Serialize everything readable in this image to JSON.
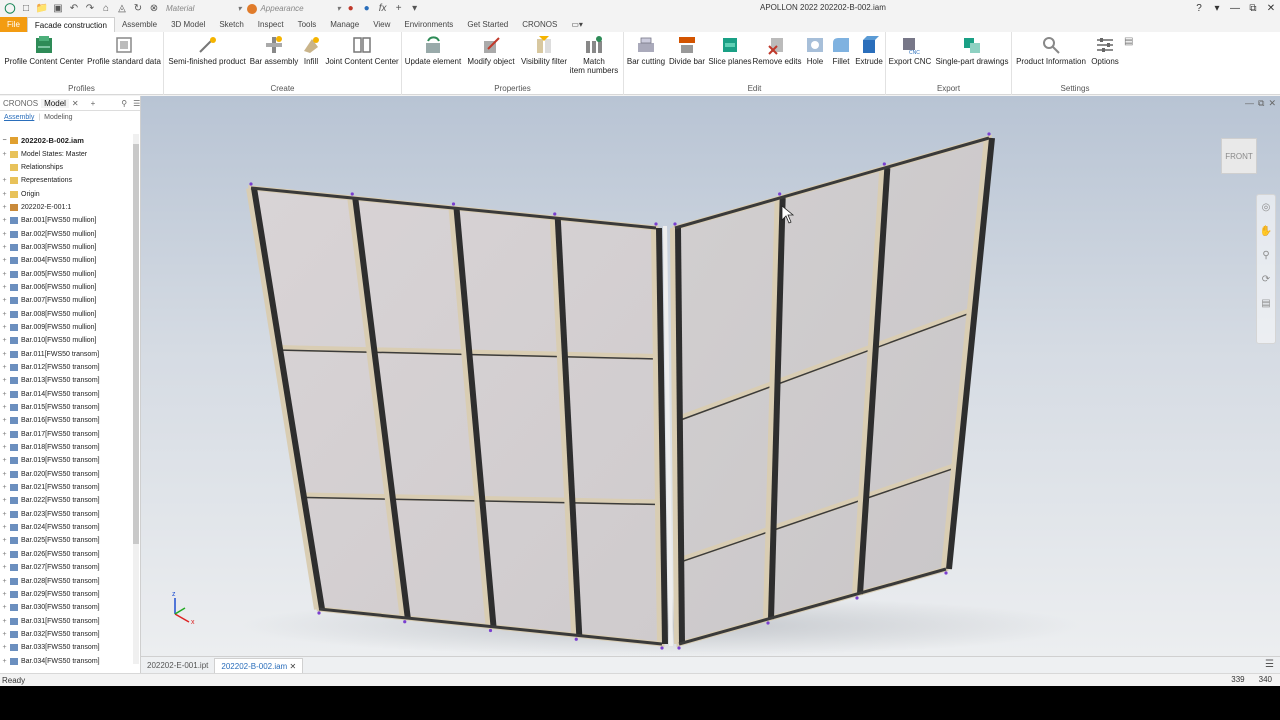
{
  "title": "APOLLON 2022   202202-B-002.iam",
  "quick_access": {
    "material": "Material",
    "appearance": "Appearance"
  },
  "tabs": [
    "File",
    "Facade construction",
    "Assemble",
    "3D Model",
    "Sketch",
    "Inspect",
    "Tools",
    "Manage",
    "View",
    "Environments",
    "Get Started",
    "CRONOS"
  ],
  "ribbon": {
    "groups": {
      "profiles": "Profiles",
      "create": "Create",
      "properties": "Properties",
      "edit": "Edit",
      "export": "Export",
      "settings": "Settings"
    },
    "buttons": {
      "profile_content_center": "Profile Content Center",
      "profile_standard_data": "Profile standard data",
      "semi_finished_product": "Semi-finished product",
      "bar_assembly": "Bar assembly",
      "infill": "Infill",
      "joint_content_center": "Joint Content Center",
      "update_element": "Update element",
      "modify_object": "Modify object",
      "visibility_filter": "Visibility filter",
      "match_item_numbers_1": "Match",
      "match_item_numbers_2": "item numbers",
      "bar_cutting": "Bar cutting",
      "divide_bar": "Divide bar",
      "slice_planes": "Slice planes",
      "remove_edits": "Remove edits",
      "hole": "Hole",
      "fillet": "Fillet",
      "extrude": "Extrude",
      "export_cnc": "Export CNC",
      "single_part_drawings": "Single-part drawings",
      "product_information": "Product Information",
      "options": "Options"
    }
  },
  "browser": {
    "tabs": [
      "CRONOS",
      "Model"
    ],
    "subtabs": [
      "Assembly",
      "Modeling"
    ],
    "root": "202202-B-002.iam",
    "nodes": [
      "Model States: Master",
      "Relationships",
      "Representations",
      "Origin",
      "202202-E-001:1",
      "Bar.001[FWS50 mullion]",
      "Bar.002[FWS50 mullion]",
      "Bar.003[FWS50 mullion]",
      "Bar.004[FWS50 mullion]",
      "Bar.005[FWS50 mullion]",
      "Bar.006[FWS50 mullion]",
      "Bar.007[FWS50 mullion]",
      "Bar.008[FWS50 mullion]",
      "Bar.009[FWS50 mullion]",
      "Bar.010[FWS50 mullion]",
      "Bar.011[FWS50 transom]",
      "Bar.012[FWS50 transom]",
      "Bar.013[FWS50 transom]",
      "Bar.014[FWS50 transom]",
      "Bar.015[FWS50 transom]",
      "Bar.016[FWS50 transom]",
      "Bar.017[FWS50 transom]",
      "Bar.018[FWS50 transom]",
      "Bar.019[FWS50 transom]",
      "Bar.020[FWS50 transom]",
      "Bar.021[FWS50 transom]",
      "Bar.022[FWS50 transom]",
      "Bar.023[FWS50 transom]",
      "Bar.024[FWS50 transom]",
      "Bar.025[FWS50 transom]",
      "Bar.026[FWS50 transom]",
      "Bar.027[FWS50 transom]",
      "Bar.028[FWS50 transom]",
      "Bar.029[FWS50 transom]",
      "Bar.030[FWS50 transom]",
      "Bar.031[FWS50 transom]",
      "Bar.032[FWS50 transom]",
      "Bar.033[FWS50 transom]",
      "Bar.034[FWS50 transom]"
    ]
  },
  "viewcube": "FRONT",
  "doc_tabs": [
    "202202-E-001.ipt",
    "202202-B-002.iam"
  ],
  "status": {
    "text": "Ready",
    "num1": "339",
    "num2": "340"
  }
}
